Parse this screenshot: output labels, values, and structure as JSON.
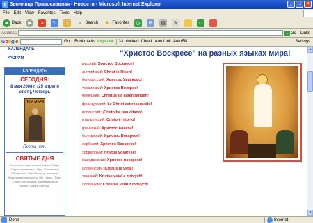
{
  "window": {
    "title": "Звонница Православная - Новости - Microsoft Internet Explorer"
  },
  "menu": [
    "File",
    "Edit",
    "View",
    "Favorites",
    "Tools",
    "Help"
  ],
  "toolbar": {
    "back": "Back",
    "search": "Search",
    "favorites": "Favorites"
  },
  "addressbar": {
    "label": "Address",
    "go": "Go",
    "links": "Links"
  },
  "googlebar": {
    "logo": "Google",
    "go": "Go",
    "bookmarks": "Bookmarks",
    "pagerank": "PageRank",
    "blocked": "33 blocked",
    "check": "Check",
    "autolink": "AutoLink",
    "autofill": "AutoFill",
    "settings": "Settings"
  },
  "status": {
    "left": "Done",
    "zone": "Internet"
  },
  "nav": {
    "calendar": "КАЛЕНДАРЬ",
    "forum": "ФОРУМ"
  },
  "calendar": {
    "header": "Календарь",
    "today": "СЕГОДНЯ:",
    "date": "8 мая 2008 г. (25 апреля ст.ст.), Четверг.",
    "icon_caption": "ПСМ МАРК",
    "fast": "Поста нет.",
    "holy_title": "СВЯТЫЕ ДНЯ",
    "holy_text": "Апостола и евангелиста Марка. Свщм. Сергия пресвитера. Прп. Сильвестра Обнорского. Свт. Макария, епископа Константинопольского. Мч. Никос. Прпп. 3-ндра пустынника. Царевградской иконы Божией Матери."
  },
  "headline": "\"Христос Воскресе\" на разных языках мира!",
  "languages": [
    {
      "name": "русский:",
      "phrase": "Христос Воскресе!"
    },
    {
      "name": "английский:",
      "phrase": "Christ is Risen!"
    },
    {
      "name": "белорусский:",
      "phrase": "Христос Уваскрос!"
    },
    {
      "name": "украинский:",
      "phrase": "Христос Воскрес!"
    },
    {
      "name": "немецкий:",
      "phrase": "Christus ist auferstanden!"
    },
    {
      "name": "французский:",
      "phrase": "Le Christ est ressuscité!"
    },
    {
      "name": "испанский:",
      "phrase": "¡Cristo ha resucitado!"
    },
    {
      "name": "итальянский:",
      "phrase": "Cristo è risorto!"
    },
    {
      "name": "греческий:",
      "phrase": "Христос Анести!"
    },
    {
      "name": "болгарский:",
      "phrase": "Христос Воскресе!"
    },
    {
      "name": "сербский:",
      "phrase": "Христос Воскресе!"
    },
    {
      "name": "хорватский:",
      "phrase": "Hrlstos voskrese!"
    },
    {
      "name": "македонский:",
      "phrase": "Христос воскресе!"
    },
    {
      "name": "словенский:",
      "phrase": "Kristus je vstal!"
    },
    {
      "name": "чешский:",
      "phrase": "Kristus vstal z mrtvých!"
    },
    {
      "name": "словацкий:",
      "phrase": "Christos vstal z mŕtvych!"
    }
  ]
}
